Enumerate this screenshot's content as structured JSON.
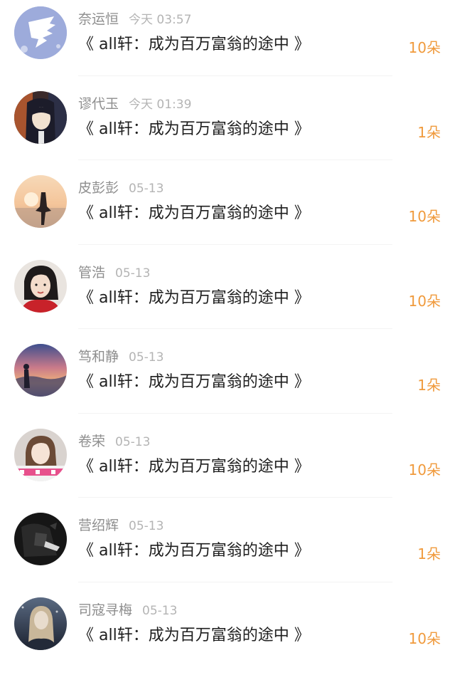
{
  "title_prefix": "《",
  "title_suffix": "》",
  "gift_unit": "朵",
  "colors": {
    "count": "#f09a3c",
    "name": "#8e8e8e",
    "time": "#b4b4b4",
    "title": "#1e1e1e"
  },
  "entries": [
    {
      "name": "奈运恒",
      "time": "今天 03:57",
      "work_title": "all轩：成为百万富翁的途中",
      "count": "10朵",
      "avatar": "angel-wing-avatar"
    },
    {
      "name": "谬代玉",
      "time": "今天 01:39",
      "work_title": "all轩：成为百万富翁的途中",
      "count": "1朵",
      "avatar": "anime-girl-avatar"
    },
    {
      "name": "皮彭彭",
      "time": "05-13",
      "work_title": "all轩：成为百万富翁的途中",
      "count": "10朵",
      "avatar": "sunset-beach-avatar"
    },
    {
      "name": "管浩",
      "time": "05-13",
      "work_title": "all轩：成为百万富翁的途中",
      "count": "10朵",
      "avatar": "portrait-red-avatar"
    },
    {
      "name": "笃和静",
      "time": "05-13",
      "work_title": "all轩：成为百万富翁的途中",
      "count": "1朵",
      "avatar": "dusk-sky-avatar"
    },
    {
      "name": "卷荣",
      "time": "05-13",
      "work_title": "all轩：成为百万富翁的途中",
      "count": "10朵",
      "avatar": "girl-pink-avatar"
    },
    {
      "name": "营绍辉",
      "time": "05-13",
      "work_title": "all轩：成为百万富翁的途中",
      "count": "1朵",
      "avatar": "dark-photo-avatar"
    },
    {
      "name": "司寇寻梅",
      "time": "05-13",
      "work_title": "all轩：成为百万富翁的途中",
      "count": "10朵",
      "avatar": "night-girl-avatar"
    }
  ]
}
